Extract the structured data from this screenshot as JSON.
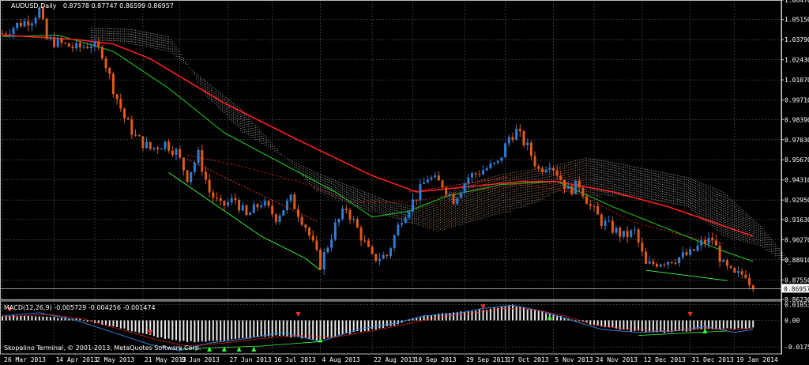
{
  "main_chart": {
    "symbol": "AUDUSD,Daily",
    "ohlc": "0.87578 0.87747 0.86599 0.86957",
    "current_price_label": "0.86957",
    "current_price": 0.86957
  },
  "macd_panel": {
    "title": "MACD(12,26,9) -0.005729 -0.004256 -0.001474",
    "credit": "Skopalino Terminal, © 2001-2013, MetaQuotes Software Corp."
  },
  "chart_data": [
    {
      "type": "candlestick",
      "title": "AUDUSD,Daily",
      "ylim": [
        0.8623,
        1.0647
      ],
      "y_ticks": [
        1.0647,
        1.0515,
        1.0379,
        1.0243,
        1.0107,
        0.9971,
        0.9839,
        0.9703,
        0.9567,
        0.9431,
        0.9295,
        0.9163,
        0.9027,
        0.8891,
        0.8755,
        0.8623
      ],
      "y_tick_labels": [
        "1.06470",
        "1.05150",
        "1.03790",
        "1.02430",
        "1.01070",
        "0.99710",
        "0.98390",
        "0.97030",
        "0.95670",
        "0.94310",
        "0.92950",
        "0.91630",
        "0.90270",
        "0.88910",
        "0.87550",
        "0.86230"
      ],
      "x_range": [
        0,
        210
      ],
      "x_tick_positions": [
        0,
        14,
        25,
        38,
        48,
        61,
        73,
        86,
        100,
        111,
        125,
        136,
        149,
        160,
        173,
        186,
        198
      ],
      "x_tick_labels": [
        "26 Mar 2013",
        "14 Apr 2013",
        "2 May 2013",
        "21 May 2013",
        "9 Jun 2013",
        "27 Jun 2013",
        "16 Jul 2013",
        "4 Aug 2013",
        "22 Aug 2013",
        "10 Sep 2013",
        "29 Sep 2013",
        "17 Oct 2013",
        "5 Nov 2013",
        "24 Nov 2013",
        "12 Dec 2013",
        "31 Dec 2013",
        "19 Jan 2014"
      ],
      "close_path": [
        [
          0,
          1.042
        ],
        [
          4,
          1.048
        ],
        [
          8,
          1.052
        ],
        [
          10,
          1.058
        ],
        [
          12,
          1.038
        ],
        [
          16,
          1.035
        ],
        [
          20,
          1.032
        ],
        [
          24,
          1.035
        ],
        [
          27,
          1.029
        ],
        [
          30,
          1.005
        ],
        [
          33,
          0.985
        ],
        [
          36,
          0.972
        ],
        [
          40,
          0.964
        ],
        [
          44,
          0.968
        ],
        [
          47,
          0.962
        ],
        [
          50,
          0.945
        ],
        [
          53,
          0.96
        ],
        [
          56,
          0.935
        ],
        [
          59,
          0.925
        ],
        [
          63,
          0.93
        ],
        [
          66,
          0.918
        ],
        [
          70,
          0.928
        ],
        [
          74,
          0.918
        ],
        [
          78,
          0.93
        ],
        [
          82,
          0.912
        ],
        [
          86,
          0.886
        ],
        [
          90,
          0.912
        ],
        [
          93,
          0.924
        ],
        [
          96,
          0.91
        ],
        [
          100,
          0.89
        ],
        [
          104,
          0.892
        ],
        [
          108,
          0.918
        ],
        [
          112,
          0.932
        ],
        [
          115,
          0.945
        ],
        [
          119,
          0.94
        ],
        [
          122,
          0.93
        ],
        [
          126,
          0.945
        ],
        [
          130,
          0.95
        ],
        [
          134,
          0.954
        ],
        [
          137,
          0.972
        ],
        [
          139,
          0.976
        ],
        [
          142,
          0.965
        ],
        [
          145,
          0.95
        ],
        [
          148,
          0.955
        ],
        [
          150,
          0.948
        ],
        [
          153,
          0.936
        ],
        [
          156,
          0.94
        ],
        [
          159,
          0.925
        ],
        [
          162,
          0.915
        ],
        [
          165,
          0.91
        ],
        [
          168,
          0.905
        ],
        [
          171,
          0.908
        ],
        [
          174,
          0.885
        ],
        [
          178,
          0.888
        ],
        [
          182,
          0.89
        ],
        [
          186,
          0.893
        ],
        [
          189,
          0.9
        ],
        [
          192,
          0.903
        ],
        [
          195,
          0.885
        ],
        [
          198,
          0.878
        ],
        [
          201,
          0.88
        ],
        [
          203,
          0.8696
        ]
      ],
      "moving_averages": {
        "red": [
          [
            0,
            1.041
          ],
          [
            20,
            1.038
          ],
          [
            30,
            1.035
          ],
          [
            40,
            1.025
          ],
          [
            60,
            0.995
          ],
          [
            80,
            0.97
          ],
          [
            100,
            0.946
          ],
          [
            112,
            0.935
          ],
          [
            124,
            0.938
          ],
          [
            140,
            0.942
          ],
          [
            150,
            0.942
          ],
          [
            165,
            0.935
          ],
          [
            180,
            0.925
          ],
          [
            195,
            0.912
          ],
          [
            203,
            0.905
          ]
        ],
        "green": [
          [
            0,
            1.04
          ],
          [
            15,
            1.041
          ],
          [
            30,
            1.03
          ],
          [
            45,
            1.005
          ],
          [
            60,
            0.975
          ],
          [
            75,
            0.955
          ],
          [
            90,
            0.935
          ],
          [
            100,
            0.918
          ],
          [
            110,
            0.922
          ],
          [
            120,
            0.932
          ],
          [
            135,
            0.94
          ],
          [
            150,
            0.942
          ],
          [
            165,
            0.925
          ],
          [
            180,
            0.91
          ],
          [
            195,
            0.895
          ],
          [
            203,
            0.888
          ]
        ],
        "darkred": [
          [
            50,
            0.96
          ],
          [
            65,
            0.952
          ],
          [
            80,
            0.942
          ],
          [
            95,
            0.928
          ],
          [
            110,
            0.928
          ],
          [
            125,
            0.935
          ],
          [
            140,
            0.94
          ],
          [
            155,
            0.935
          ],
          [
            170,
            0.915
          ],
          [
            185,
            0.905
          ],
          [
            195,
            0.9
          ]
        ]
      },
      "ichimoku_cloud": {
        "upper": [
          [
            24,
            1.046
          ],
          [
            35,
            1.045
          ],
          [
            45,
            1.04
          ],
          [
            48,
            1.03
          ],
          [
            55,
            1.0
          ],
          [
            65,
            0.975
          ],
          [
            75,
            0.96
          ],
          [
            85,
            0.948
          ],
          [
            95,
            0.938
          ],
          [
            105,
            0.928
          ],
          [
            112,
            0.925
          ],
          [
            118,
            0.93
          ],
          [
            125,
            0.94
          ],
          [
            135,
            0.947
          ],
          [
            148,
            0.952
          ],
          [
            158,
            0.958
          ],
          [
            165,
            0.955
          ],
          [
            175,
            0.95
          ],
          [
            185,
            0.945
          ],
          [
            195,
            0.935
          ],
          [
            205,
            0.912
          ],
          [
            213,
            0.888
          ]
        ],
        "lower": [
          [
            24,
            1.037
          ],
          [
            35,
            1.035
          ],
          [
            45,
            1.03
          ],
          [
            55,
            1.01
          ],
          [
            65,
            0.99
          ],
          [
            75,
            0.962
          ],
          [
            85,
            0.935
          ],
          [
            95,
            0.925
          ],
          [
            105,
            0.918
          ],
          [
            112,
            0.912
          ],
          [
            118,
            0.908
          ],
          [
            125,
            0.913
          ],
          [
            135,
            0.92
          ],
          [
            145,
            0.928
          ],
          [
            150,
            0.935
          ],
          [
            158,
            0.932
          ],
          [
            165,
            0.932
          ],
          [
            175,
            0.93
          ],
          [
            185,
            0.925
          ],
          [
            195,
            0.905
          ],
          [
            205,
            0.898
          ],
          [
            213,
            0.885
          ]
        ]
      },
      "support_lines": [
        {
          "color": "#3cff3c",
          "points": [
            [
              45,
              0.948
            ],
            [
              70,
              0.905
            ],
            [
              82,
              0.89
            ],
            [
              86,
              0.882
            ]
          ]
        },
        {
          "color": "#3cff3c",
          "points": [
            [
              174,
              0.882
            ],
            [
              196,
              0.875
            ]
          ]
        },
        {
          "color": "#ff3030",
          "points": [
            [
              50,
              0.957
            ],
            [
              85,
              0.915
            ]
          ]
        },
        {
          "color": "#ff3030",
          "points": [
            [
              110,
              0.935
            ],
            [
              137,
              0.945
            ]
          ]
        }
      ]
    },
    {
      "type": "bar",
      "title": "MACD(12,26,9) -0.005729 -0.004256 -0.001474",
      "ylim": [
        -0.0222,
        0.0128
      ],
      "y_ticks": [
        0.010535,
        0.0,
        -0.017591
      ],
      "y_tick_labels": [
        "0.010535",
        "0.00",
        "-0.017591"
      ],
      "histogram": [
        [
          0,
          0.003
        ],
        [
          10,
          0.003
        ],
        [
          20,
          0.001
        ],
        [
          30,
          -0.004
        ],
        [
          40,
          -0.01
        ],
        [
          48,
          -0.014
        ],
        [
          55,
          -0.014
        ],
        [
          65,
          -0.012
        ],
        [
          75,
          -0.01
        ],
        [
          85,
          -0.013
        ],
        [
          95,
          -0.008
        ],
        [
          105,
          -0.004
        ],
        [
          112,
          0.002
        ],
        [
          120,
          0.005
        ],
        [
          130,
          0.007
        ],
        [
          138,
          0.01
        ],
        [
          145,
          0.006
        ],
        [
          152,
          0.002
        ],
        [
          160,
          -0.003
        ],
        [
          170,
          -0.007
        ],
        [
          180,
          -0.008
        ],
        [
          190,
          -0.006
        ],
        [
          203,
          -0.005
        ]
      ],
      "macd_line": [
        [
          0,
          0.003
        ],
        [
          10,
          0.005
        ],
        [
          20,
          0.0
        ],
        [
          30,
          -0.008
        ],
        [
          40,
          -0.016
        ],
        [
          48,
          -0.02
        ],
        [
          56,
          -0.015
        ],
        [
          66,
          -0.012
        ],
        [
          76,
          -0.008
        ],
        [
          86,
          -0.014
        ],
        [
          96,
          -0.006
        ],
        [
          106,
          -0.002
        ],
        [
          114,
          0.003
        ],
        [
          122,
          0.004
        ],
        [
          130,
          0.008
        ],
        [
          138,
          0.01
        ],
        [
          146,
          0.006
        ],
        [
          154,
          0.0
        ],
        [
          162,
          -0.006
        ],
        [
          172,
          -0.008
        ],
        [
          182,
          -0.007
        ],
        [
          190,
          -0.004
        ],
        [
          198,
          -0.008
        ],
        [
          203,
          -0.006
        ]
      ],
      "signal_line": [
        [
          0,
          0.002
        ],
        [
          12,
          0.004
        ],
        [
          22,
          0.001
        ],
        [
          32,
          -0.006
        ],
        [
          42,
          -0.013
        ],
        [
          50,
          -0.017
        ],
        [
          60,
          -0.015
        ],
        [
          70,
          -0.012
        ],
        [
          80,
          -0.01
        ],
        [
          90,
          -0.011
        ],
        [
          100,
          -0.007
        ],
        [
          110,
          -0.002
        ],
        [
          118,
          0.002
        ],
        [
          128,
          0.005
        ],
        [
          136,
          0.008
        ],
        [
          144,
          0.007
        ],
        [
          152,
          0.003
        ],
        [
          160,
          -0.003
        ],
        [
          170,
          -0.006
        ],
        [
          180,
          -0.007
        ],
        [
          190,
          -0.005
        ],
        [
          198,
          -0.006
        ],
        [
          203,
          -0.005
        ]
      ]
    }
  ],
  "colors": {
    "background": "#000000",
    "grid": "#5a5a5a",
    "bull": "#2e7dd6",
    "bear": "#e05a1a",
    "cloud_down": "#e8e8e8",
    "cloud_up": "#f0b88a",
    "ma_red": "#ff2020",
    "ma_green": "#20c020",
    "macd_hist": "#e8e8e8",
    "macd_line": "#2e7dd6",
    "signal_line": "#ff2020",
    "arrow_green": "#3cff3c",
    "arrow_red": "#ff3030"
  }
}
